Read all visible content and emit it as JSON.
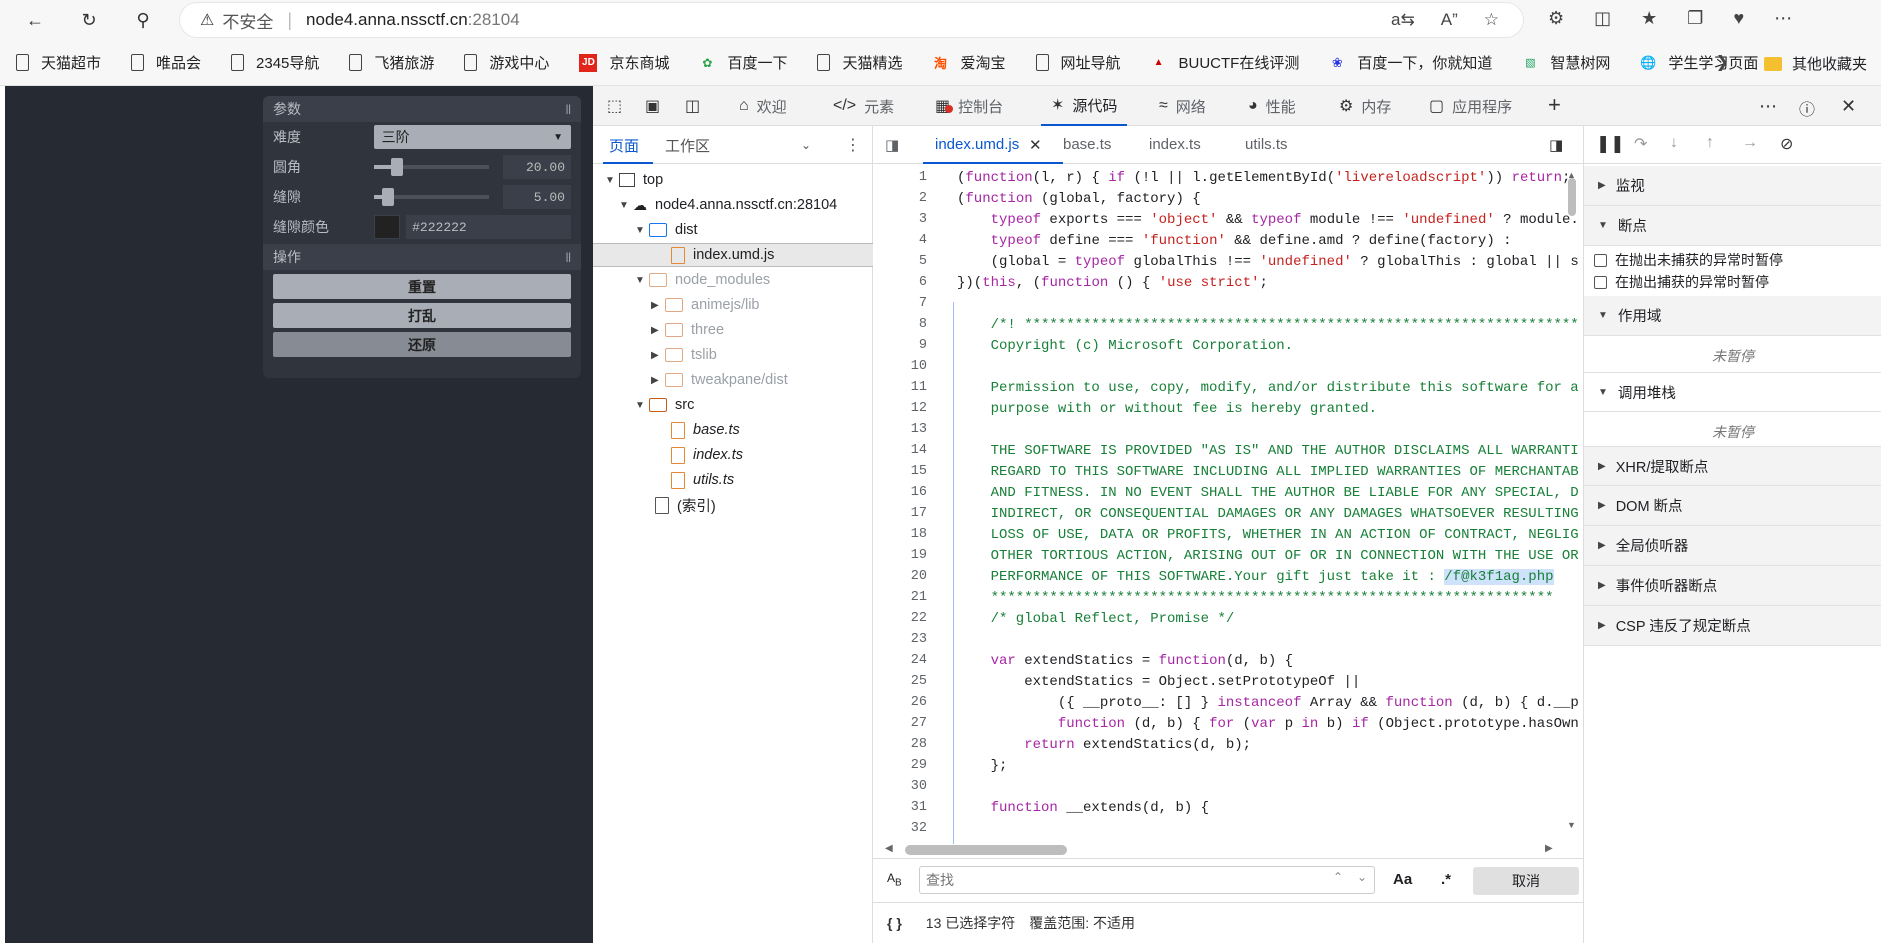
{
  "browser": {
    "security_label": "不安全",
    "url_host": "node4.anna.nssctf.cn",
    "url_port": ":28104"
  },
  "bookmarks": [
    {
      "label": "天猫超市",
      "icon": "file-icon"
    },
    {
      "label": "唯品会",
      "icon": "file-icon"
    },
    {
      "label": "2345导航",
      "icon": "file-icon"
    },
    {
      "label": "飞猪旅游",
      "icon": "file-icon"
    },
    {
      "label": "游戏中心",
      "icon": "file-icon"
    },
    {
      "label": "京东商城",
      "icon": "jd-icon"
    },
    {
      "label": "百度一下",
      "icon": "2345-icon"
    },
    {
      "label": "天猫精选",
      "icon": "file-icon"
    },
    {
      "label": "爱淘宝",
      "icon": "taobao-icon"
    },
    {
      "label": "网址导航",
      "icon": "file-icon"
    },
    {
      "label": "BUUCTF在线评测",
      "icon": "buuctf-icon"
    },
    {
      "label": "百度一下，你就知道",
      "icon": "baidu-icon"
    },
    {
      "label": "智慧树网",
      "icon": "zhihuishu-icon"
    },
    {
      "label": "学生学习页面",
      "icon": "globe-icon"
    }
  ],
  "bookmark_folder": "其他收藏夹",
  "tweakpane": {
    "params_title": "参数",
    "difficulty_label": "难度",
    "difficulty_value": "三阶",
    "radius_label": "圆角",
    "radius_value": "20.00",
    "radius_fraction": 0.18,
    "gap_label": "缝隙",
    "gap_value": "5.00",
    "gap_fraction": 0.08,
    "gap_color_label": "缝隙颜色",
    "gap_color_value": "#222222",
    "ops_title": "操作",
    "reset_label": "重置",
    "shuffle_label": "打乱",
    "restore_label": "还原"
  },
  "devtools": {
    "tabs": [
      {
        "label": "欢迎",
        "icon": "home-icon"
      },
      {
        "label": "元素",
        "icon": "code-icon"
      },
      {
        "label": "控制台",
        "icon": "console-icon"
      },
      {
        "label": "源代码",
        "icon": "bug-icon"
      },
      {
        "label": "网络",
        "icon": "wifi-icon"
      },
      {
        "label": "性能",
        "icon": "gauge-icon"
      },
      {
        "label": "内存",
        "icon": "gear-icon"
      },
      {
        "label": "应用程序",
        "icon": "app-icon"
      }
    ],
    "active_tab": "源代码",
    "navigator": {
      "tab_page": "页面",
      "tab_workspace": "工作区",
      "tree": {
        "top": "top",
        "host": "node4.anna.nssctf.cn:28104",
        "dist": "dist",
        "index_umd": "index.umd.js",
        "node_modules": "node_modules",
        "animejs": "animejs/lib",
        "three": "three",
        "tslib": "tslib",
        "tweakpane": "tweakpane/dist",
        "src": "src",
        "base": "base.ts",
        "index_ts": "index.ts",
        "utils": "utils.ts",
        "index_page": "(索引)"
      }
    },
    "editor_tabs": [
      "index.umd.js",
      "base.ts",
      "index.ts",
      "utils.ts"
    ],
    "code_lines": [
      "(function(l, r) { if (!l || l.getElementById('livereloadscript')) return;",
      "(function (global, factory) {",
      "    typeof exports === 'object' && typeof module !== 'undefined' ? module.",
      "    typeof define === 'function' && define.amd ? define(factory) :",
      "    (global = typeof globalThis !== 'undefined' ? globalThis : global || s",
      "})(this, (function () { 'use strict';",
      "",
      "    /*! ******************************************************************",
      "    Copyright (c) Microsoft Corporation.",
      "",
      "    Permission to use, copy, modify, and/or distribute this software for a",
      "    purpose with or without fee is hereby granted.",
      "",
      "    THE SOFTWARE IS PROVIDED \"AS IS\" AND THE AUTHOR DISCLAIMS ALL WARRANTI",
      "    REGARD TO THIS SOFTWARE INCLUDING ALL IMPLIED WARRANTIES OF MERCHANTAB",
      "    AND FITNESS. IN NO EVENT SHALL THE AUTHOR BE LIABLE FOR ANY SPECIAL, D",
      "    INDIRECT, OR CONSEQUENTIAL DAMAGES OR ANY DAMAGES WHATSOEVER RESULTING",
      "    LOSS OF USE, DATA OR PROFITS, WHETHER IN AN ACTION OF CONTRACT, NEGLIG",
      "    OTHER TORTIOUS ACTION, ARISING OUT OF OR IN CONNECTION WITH THE USE OR",
      "    PERFORMANCE OF THIS SOFTWARE.Your gift just take it : ",
      "    *******************************************************************",
      "    /* global Reflect, Promise */",
      "",
      "    var extendStatics = function(d, b) {",
      "        extendStatics = Object.setPrototypeOf ||",
      "            ({ __proto__: [] } instanceof Array && function (d, b) { d.__p",
      "            function (d, b) { for (var p in b) if (Object.prototype.hasOwn",
      "        return extendStatics(d, b);",
      "    };",
      "",
      "    function __extends(d, b) {"
    ],
    "line_numbers": [
      "1",
      "2",
      "3",
      "4",
      "5",
      "6",
      "7",
      "8",
      "9",
      "10",
      "11",
      "12",
      "13",
      "14",
      "15",
      "16",
      "17",
      "18",
      "19",
      "20",
      "21",
      "22",
      "23",
      "24",
      "25",
      "26",
      "27",
      "28",
      "29",
      "30",
      "31",
      "32"
    ],
    "highlighted_path": "/f@k3f1ag.php",
    "search": {
      "placeholder": "查找",
      "case_label": "Aa",
      "regex_label": ".*",
      "cancel_label": "取消"
    },
    "status": {
      "braces": "{ }",
      "selected": "13 已选择字符",
      "coverage": "覆盖范围: 不适用"
    },
    "debugger": {
      "watch": "监视",
      "breakpoints": "断点",
      "pause_uncaught": "在抛出未捕获的异常时暂停",
      "pause_caught": "在抛出捕获的异常时暂停",
      "scope": "作用域",
      "not_paused_1": "未暂停",
      "call_stack": "调用堆栈",
      "not_paused_2": "未暂停",
      "xhr": "XHR/提取断点",
      "dom": "DOM 断点",
      "global_listeners": "全局侦听器",
      "event_listeners": "事件侦听器断点",
      "csp": "CSP 违反了规定断点"
    }
  }
}
